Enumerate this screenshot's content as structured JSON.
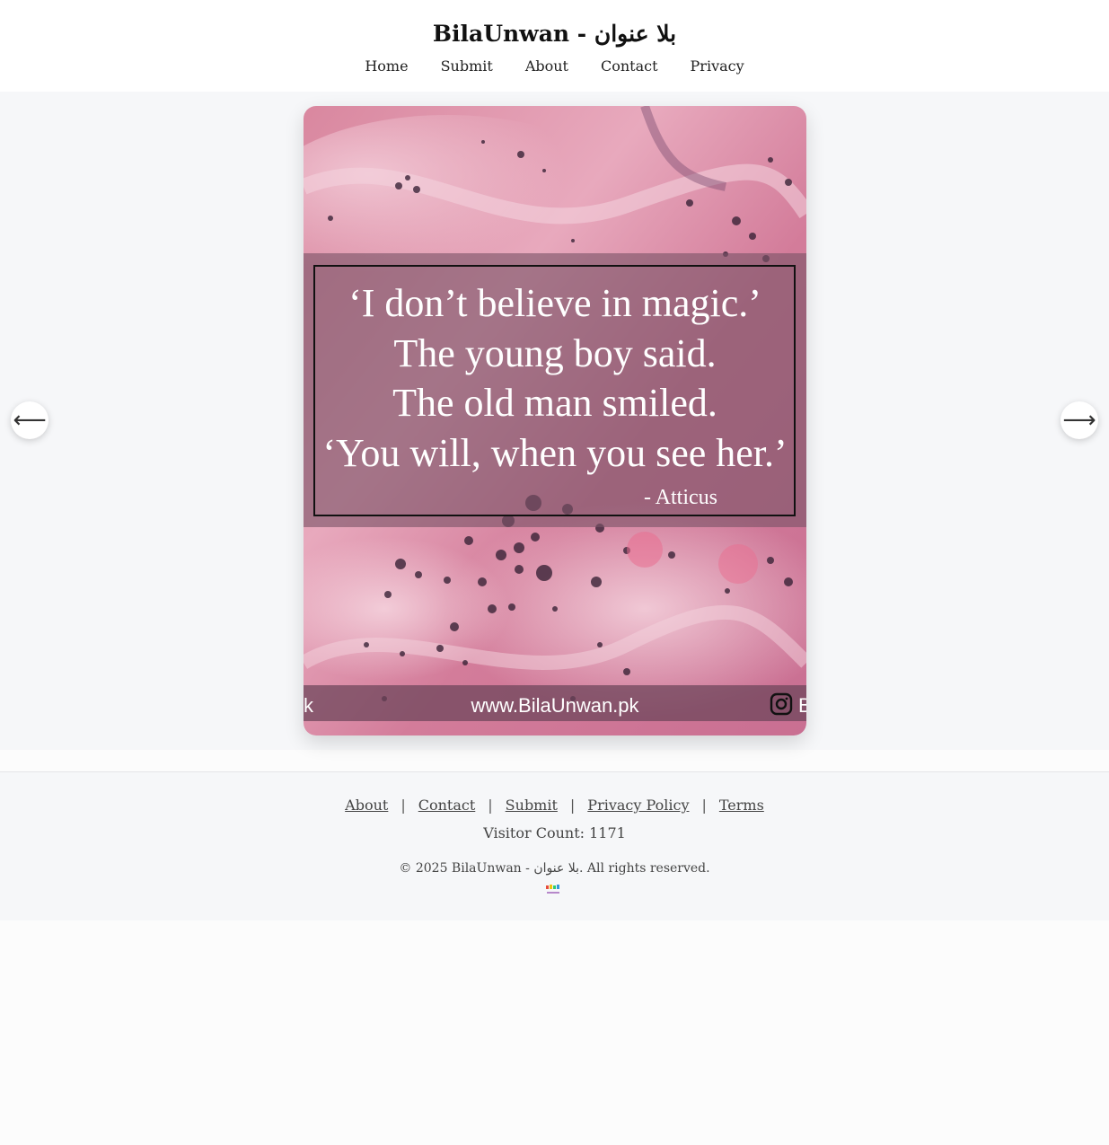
{
  "site": {
    "title": "BilaUnwan - بلا عنوان"
  },
  "nav": {
    "items": [
      "Home",
      "Submit",
      "About",
      "Contact",
      "Privacy"
    ]
  },
  "carousel": {
    "prev_symbol": "⟵",
    "next_symbol": "⟶",
    "slide": {
      "quote_lines": [
        "‘I don’t believe in magic.’",
        "The young boy said.",
        "The old man smiled.",
        "‘You will, when you see her.’"
      ],
      "attribution": "- Atticus",
      "watermark_url": "www.BilaUnwan.pk",
      "watermark_left_fragment": "k",
      "watermark_right_fragment": "B"
    }
  },
  "footer": {
    "links": [
      "About",
      "Contact",
      "Submit",
      "Privacy Policy",
      "Terms"
    ],
    "separator": "|",
    "visitor_count": "Visitor Count: 1171",
    "copyright": "© 2025 BilaUnwan - بلا عنوان. All rights reserved."
  },
  "colors": {
    "card_pink": "#d98aa8",
    "overlay_band": "#8a5a73"
  }
}
